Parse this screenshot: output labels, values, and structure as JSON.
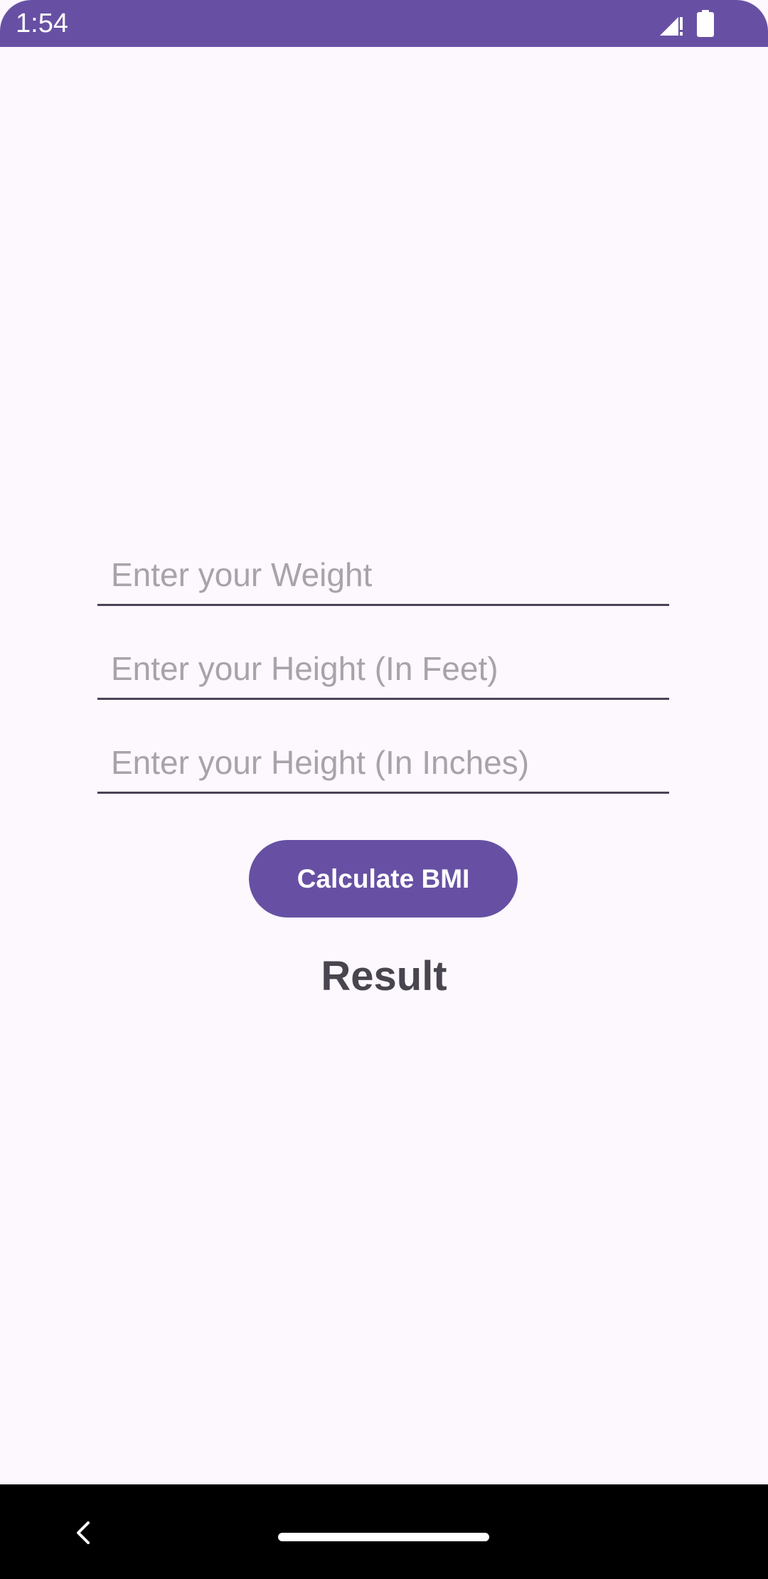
{
  "status_bar": {
    "time": "1:54",
    "signal_icon": "signal-no-data-icon",
    "battery_icon": "battery-full-icon",
    "color": "#6750a4"
  },
  "form": {
    "weight_placeholder": "Enter your Weight",
    "weight_value": "",
    "height_feet_placeholder": "Enter your Height (In Feet)",
    "height_feet_value": "",
    "height_inches_placeholder": "Enter your Height (In Inches)",
    "height_inches_value": ""
  },
  "actions": {
    "calculate_label": "Calculate BMI",
    "accent_color": "#6750a4"
  },
  "result": {
    "text": "Result"
  },
  "navigation": {
    "back_icon": "back-chevron-icon",
    "home_handle": "home-gesture-handle"
  }
}
